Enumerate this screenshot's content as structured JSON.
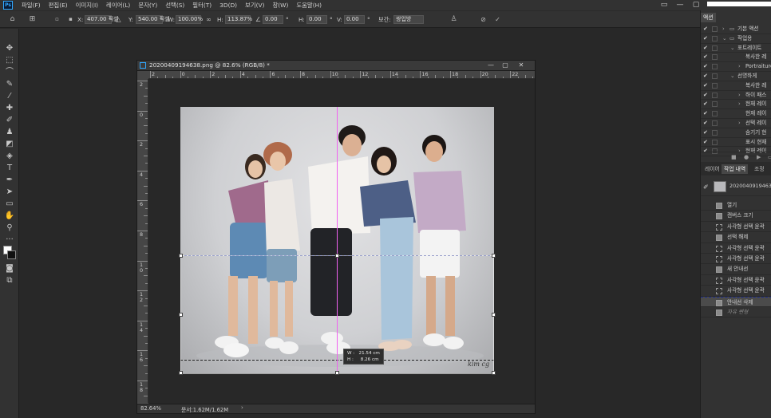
{
  "menubar": {
    "logo": "Ps",
    "items": [
      "파일(F)",
      "편집(E)",
      "이미지(I)",
      "레이어(L)",
      "문자(Y)",
      "선택(S)",
      "필터(T)",
      "3D(D)",
      "보기(V)",
      "창(W)",
      "도움말(H)"
    ],
    "window_controls": [
      "▭",
      "—",
      "▢",
      "✕"
    ]
  },
  "options": {
    "x_label": "X:",
    "x_value": "407.00 픽셀",
    "y_label": "Y:",
    "y_value": "540.00 픽셀",
    "w_label": "W:",
    "w_value": "100.00%",
    "h_label": "H:",
    "h_value": "113.87%",
    "angle_value": "0.00",
    "hskew_label": "H:",
    "hskew_value": "0.00",
    "vskew_label": "V:",
    "vskew_value": "0.00",
    "interp_label": "보간:",
    "interp_value": "쌍입방"
  },
  "document": {
    "title": "20200409194638.png @ 82.6% (RGB/8) *",
    "zoom": "82.64%",
    "info": "문서:1.62M/1.62M",
    "hruler_labels": [
      "2",
      "0",
      "2",
      "4",
      "6",
      "8",
      "10",
      "12",
      "14",
      "16",
      "18",
      "20",
      "22"
    ],
    "vruler_labels": [
      "2",
      "0",
      "2",
      "4",
      "6",
      "8",
      "10",
      "12",
      "14",
      "16",
      "18"
    ],
    "tooltip": "W :   21.54 cm\nH :     8.26 cm",
    "watermark": "kim cg"
  },
  "actions_panel": {
    "tab": "액션",
    "rows": [
      {
        "indent": 0,
        "arrow": "›",
        "folder": true,
        "label": "기본 액션"
      },
      {
        "indent": 0,
        "arrow": "⌄",
        "folder": true,
        "label": "작업용"
      },
      {
        "indent": 1,
        "arrow": "⌄",
        "folder": false,
        "label": "포트레이트"
      },
      {
        "indent": 2,
        "arrow": "",
        "folder": false,
        "label": "복사한 레"
      },
      {
        "indent": 2,
        "arrow": "›",
        "folder": false,
        "label": "Portraiture"
      },
      {
        "indent": 1,
        "arrow": "⌄",
        "folder": false,
        "label": "선명하게"
      },
      {
        "indent": 2,
        "arrow": "",
        "folder": false,
        "label": "복사한 레"
      },
      {
        "indent": 2,
        "arrow": "›",
        "folder": false,
        "label": "하이 패스"
      },
      {
        "indent": 2,
        "arrow": "›",
        "folder": false,
        "label": "현재 레이"
      },
      {
        "indent": 2,
        "arrow": "",
        "folder": false,
        "label": "현재 레이"
      },
      {
        "indent": 2,
        "arrow": "›",
        "folder": false,
        "label": "선택 레이"
      },
      {
        "indent": 2,
        "arrow": "",
        "folder": false,
        "label": "숨기기 현"
      },
      {
        "indent": 2,
        "arrow": "",
        "folder": false,
        "label": "표시 현재"
      },
      {
        "indent": 2,
        "arrow": "›",
        "folder": false,
        "label": "현재 레이"
      }
    ],
    "buttons": [
      "■",
      "●",
      "▶",
      "▭"
    ]
  },
  "history_panel": {
    "tabs": [
      "레이어",
      "작업 내역",
      "조정"
    ],
    "snapshot": "20200409194638.png",
    "rows": [
      {
        "label": "열기",
        "icon": "doc",
        "state": "normal"
      },
      {
        "label": "캔버스 크기",
        "icon": "doc",
        "state": "normal"
      },
      {
        "label": "사각형 선택 윤곽",
        "icon": "marquee",
        "state": "normal"
      },
      {
        "label": "선택 해제",
        "icon": "doc",
        "state": "normal"
      },
      {
        "label": "사각형 선택 윤곽",
        "icon": "marquee",
        "state": "normal"
      },
      {
        "label": "사각형 선택 윤곽",
        "icon": "marquee",
        "state": "normal"
      },
      {
        "label": "새 안내선",
        "icon": "doc",
        "state": "normal"
      },
      {
        "label": "사각형 선택 윤곽",
        "icon": "marquee",
        "state": "normal"
      },
      {
        "label": "사각형 선택 윤곽",
        "icon": "marquee",
        "state": "normal"
      },
      {
        "label": "안내선 삭제",
        "icon": "doc",
        "state": "selected"
      },
      {
        "label": "자유 변형",
        "icon": "doc",
        "state": "dimmed"
      }
    ]
  },
  "colors": {
    "accent": "#31a8ff",
    "guide": "#f061f0",
    "selection": "#1b2a8c"
  }
}
